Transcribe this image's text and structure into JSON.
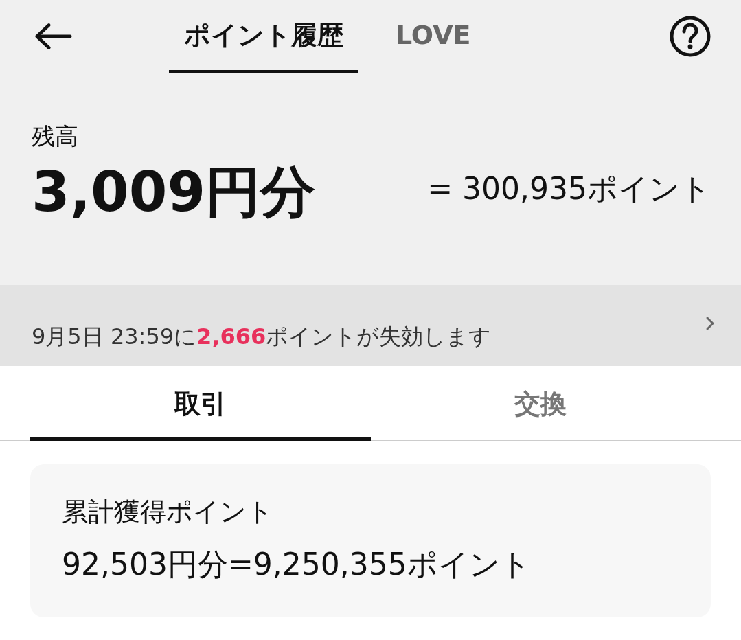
{
  "header": {
    "tabs": [
      {
        "label": "ポイント履歴",
        "selected": true
      },
      {
        "label": "LOVE",
        "selected": false
      }
    ]
  },
  "balance": {
    "label": "残高",
    "amount": "3,009円分",
    "points": "= 300,935ポイント"
  },
  "notice": {
    "before": "9月5日 23:59に",
    "highlight": "2,666",
    "after": "ポイントが失効します"
  },
  "tabs": [
    {
      "label": "取引",
      "selected": true
    },
    {
      "label": "交換",
      "selected": false
    }
  ],
  "summary": {
    "title": "累計獲得ポイント",
    "value": "92,503円分=9,250,355ポイント"
  }
}
